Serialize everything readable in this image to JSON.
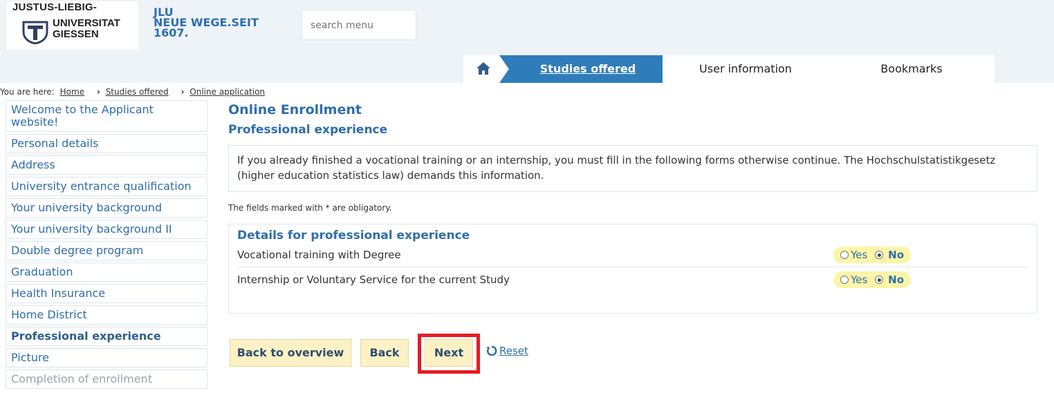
{
  "header": {
    "logo_line1": "JUSTUS-LIEBIG-",
    "logo_line2": "UNIVERSITAT",
    "logo_line3": "GIESSEN",
    "jlu_line1": "JLU",
    "jlu_line2": "NEUE WEGE.SEIT",
    "jlu_line3": "1607.",
    "search_placeholder": "search menu"
  },
  "nav": {
    "items": [
      {
        "label": "Studies offered"
      },
      {
        "label": "User information"
      },
      {
        "label": "Bookmarks"
      }
    ]
  },
  "breadcrumb": {
    "prefix": "You are here:",
    "items": [
      "Home",
      "Studies offered",
      "Online application"
    ],
    "separator": "›"
  },
  "sidebar": {
    "items": [
      {
        "label": "Welcome to the Applicant website!"
      },
      {
        "label": "Personal details"
      },
      {
        "label": "Address"
      },
      {
        "label": "University entrance qualification"
      },
      {
        "label": "Your university background"
      },
      {
        "label": "Your university background II"
      },
      {
        "label": "Double degree program"
      },
      {
        "label": "Graduation"
      },
      {
        "label": "Health Insurance"
      },
      {
        "label": "Home District"
      },
      {
        "label": "Professional experience"
      },
      {
        "label": "Picture"
      },
      {
        "label": "Completion of enrollment"
      }
    ]
  },
  "main": {
    "title": "Online Enrollment",
    "subtitle": "Professional experience",
    "info": "If you already finished a vocational training or an internship, you must fill in the following forms otherwise continue. The Hochschulstatistikgesetz (higher education statistics law) demands this information.",
    "note": "The fields marked with * are obligatory.",
    "details_title": "Details for professional experience",
    "rows": [
      {
        "label": "Vocational training with Degree",
        "yes": "Yes",
        "no": "No"
      },
      {
        "label": "Internship or Voluntary Service for the current Study",
        "yes": "Yes",
        "no": "No"
      }
    ]
  },
  "buttons": {
    "back_overview": "Back to overview",
    "back": "Back",
    "next": "Next",
    "reset": "Reset"
  },
  "colors": {
    "accent": "#2e7db9",
    "link": "#2e6eac",
    "button_bg": "#fbf1c5",
    "highlight": "#e41c24",
    "radio_highlight": "#fbf5a8"
  }
}
